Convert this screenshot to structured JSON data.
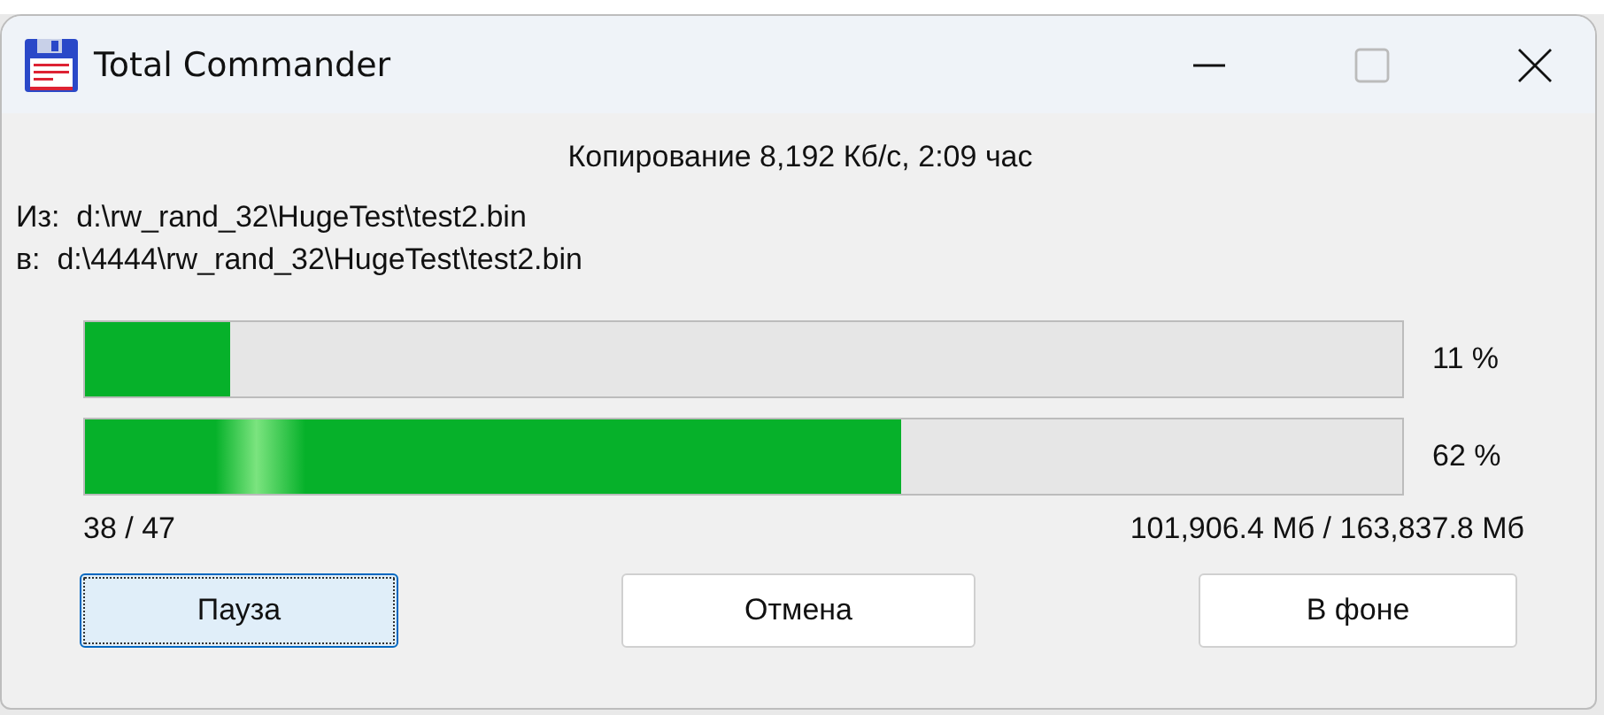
{
  "window": {
    "title": "Total Commander"
  },
  "status": "Копирование 8,192 Кб/с, 2:09 час",
  "paths": [
    {
      "label": "Из:",
      "path": "d:\\rw_rand_32\\HugeTest\\test2.bin"
    },
    {
      "label": "в:",
      "path": "d:\\4444\\rw_rand_32\\HugeTest\\test2.bin"
    }
  ],
  "progress": [
    {
      "level": 0.11,
      "reading": "11 %"
    },
    {
      "level": 0.62,
      "reading": "62 %"
    }
  ],
  "files_count": "38 / 47",
  "size_count": "101,906.4 Мб / 163,837.8 Мб",
  "buttons": [
    {
      "label": "Пауза",
      "focused": true
    },
    {
      "label": "Отмена",
      "focused": false
    },
    {
      "label": "В фоне",
      "focused": false
    }
  ]
}
